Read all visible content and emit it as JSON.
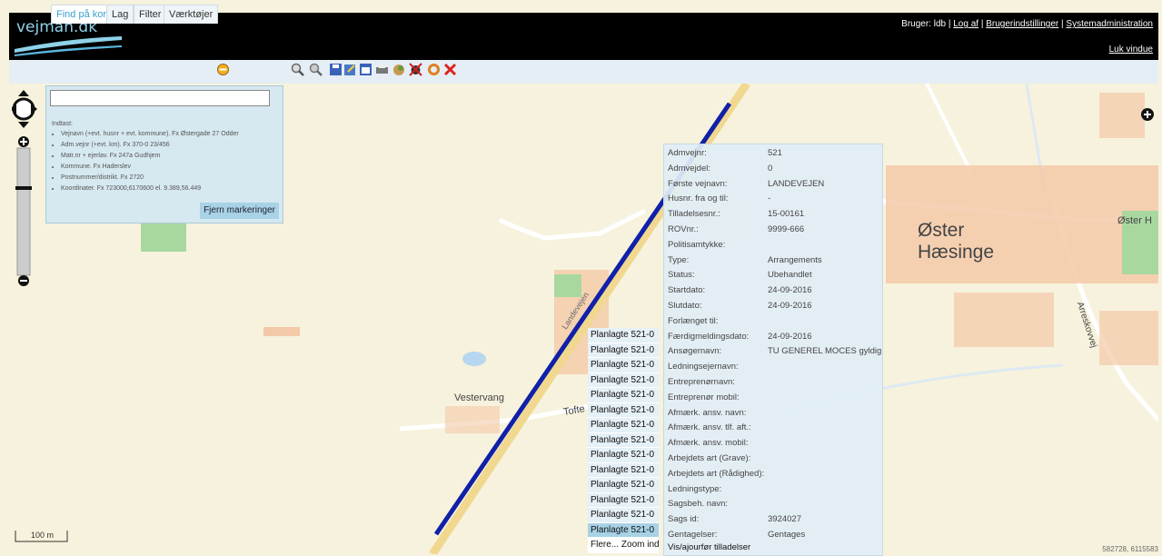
{
  "header": {
    "logo": "vejman.dk",
    "user_label": "Bruger: ldb",
    "logout": "Log af",
    "user_settings": "Brugerindstillinger",
    "sysadmin": "Systemadministration",
    "close_window": "Luk vindue"
  },
  "tabs": [
    "Find på kort",
    "Lag",
    "Filter",
    "Værktøjer"
  ],
  "toolbar_icons": [
    "zoom-in-icon",
    "zoom-out-icon",
    "save-icon",
    "edit-icon",
    "calendar-icon",
    "print-icon",
    "layers-icon",
    "delete-bug-icon",
    "refresh-icon",
    "close-icon"
  ],
  "search": {
    "placeholder": "",
    "intro": "Indtast:",
    "hints": [
      "Vejnavn (+evt. husnr + evt. kommune). Fx Østergade 27 Odder",
      "Adm.vejnr (+evt. km). Fx 370-0 23/456",
      "Matr.nr + ejerlav. Fx 247a Gudhjem",
      "Kommune. Fx Haderslev",
      "Postnummer/distrikt. Fx 2720",
      "Koordinater. Fx 723000,6170600 el. 9.389,56.449"
    ],
    "clear_button": "Fjern markeringer"
  },
  "popup": {
    "rows": [
      {
        "label": "Admvejnr:",
        "value": "521"
      },
      {
        "label": "Admvejdel:",
        "value": "0"
      },
      {
        "label": "Første vejnavn:",
        "value": "LANDEVEJEN"
      },
      {
        "label": "Husnr. fra og til:",
        "value": "-"
      },
      {
        "label": "Tilladelsesnr.:",
        "value": "15-00161"
      },
      {
        "label": "ROVnr.:",
        "value": "9999-666"
      },
      {
        "label": "Politisamtykke:",
        "value": ""
      },
      {
        "label": "Type:",
        "value": "Arrangements"
      },
      {
        "label": "Status:",
        "value": "Ubehandlet"
      },
      {
        "label": "Startdato:",
        "value": "24-09-2016"
      },
      {
        "label": "Slutdato:",
        "value": "24-09-2016"
      },
      {
        "label": "Forlænget til:",
        "value": ""
      },
      {
        "label": "Færdigmeldingsdato:",
        "value": "24-09-2016"
      },
      {
        "label": "Ansøgernavn:",
        "value": "TU GENEREL MOCES gyldig"
      },
      {
        "label": "Ledningsejernavn:",
        "value": ""
      },
      {
        "label": "Entreprenørnavn:",
        "value": ""
      },
      {
        "label": "Entreprenør mobil:",
        "value": ""
      },
      {
        "label": "Afmærk. ansv. navn:",
        "value": ""
      },
      {
        "label": "Afmærk. ansv. tlf. aft.:",
        "value": ""
      },
      {
        "label": "Afmærk. ansv. mobil:",
        "value": ""
      },
      {
        "label": "Arbejdets art (Grave):",
        "value": ""
      },
      {
        "label": "Arbejdets art (Rådighed):",
        "value": ""
      },
      {
        "label": "Ledningstype:",
        "value": ""
      },
      {
        "label": "Sagsbeh. navn:",
        "value": ""
      },
      {
        "label": "Sags id:",
        "value": "3924027"
      },
      {
        "label": "Gentagelser:",
        "value": "Gentages"
      }
    ],
    "footer": "Vis/ajourfør tilladelser"
  },
  "planned_list": {
    "items": [
      "Planlagte 521-0",
      "Planlagte 521-0",
      "Planlagte 521-0",
      "Planlagte 521-0",
      "Planlagte 521-0",
      "Planlagte 521-0",
      "Planlagte 521-0",
      "Planlagte 521-0",
      "Planlagte 521-0",
      "Planlagte 521-0",
      "Planlagte 521-0",
      "Planlagte 521-0",
      "Planlagte 521-0",
      "Planlagte 521-0"
    ],
    "selected_index": 13,
    "more": "Flere... Zoom ind"
  },
  "map_labels": {
    "village": "Øster\nHæsinge",
    "village_edge": "Øster H",
    "vestervang": "Vestervang",
    "tofte": "Tofte",
    "arreskovvej": "Arreskovvej",
    "road_label": "Landevejen"
  },
  "scale": "100 m",
  "coords": "582728, 6115583",
  "colors": {
    "header_bg": "#000000",
    "accent": "#3a9fcf",
    "road_highlight": "#1020a8",
    "popup_bg": "#e1eef5"
  }
}
